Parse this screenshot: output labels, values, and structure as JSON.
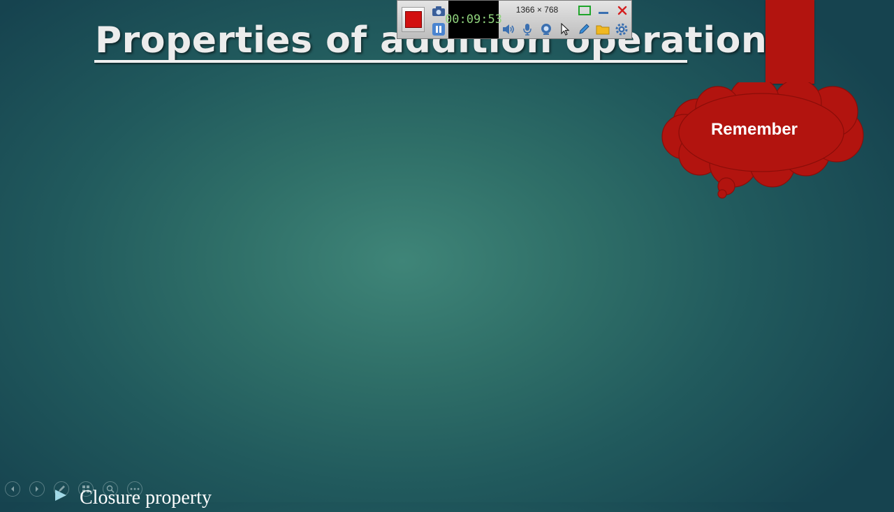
{
  "slide": {
    "title": "Properties of addition operation",
    "callout": "Remember",
    "bullet_text": "Closure property"
  },
  "recorder": {
    "timer": "00:09:53",
    "resolution": "1366 × 768"
  },
  "icons": {
    "recorder": [
      "stop-icon",
      "camera-icon",
      "pause-icon",
      "speaker-icon",
      "microphone-icon",
      "webcam-icon",
      "cursor-icon",
      "pen-icon",
      "folder-icon",
      "gear-icon",
      "rectangle-icon",
      "minimize-icon",
      "close-icon"
    ],
    "presentation": [
      "previous-icon",
      "next-icon",
      "pen-icon",
      "slides-grid-icon",
      "zoom-icon",
      "more-icon"
    ]
  },
  "colors": {
    "background_center": "#3f8578",
    "background_edge": "#16434f",
    "accent_red": "#b2140f",
    "timer_green": "#8fd27c"
  }
}
